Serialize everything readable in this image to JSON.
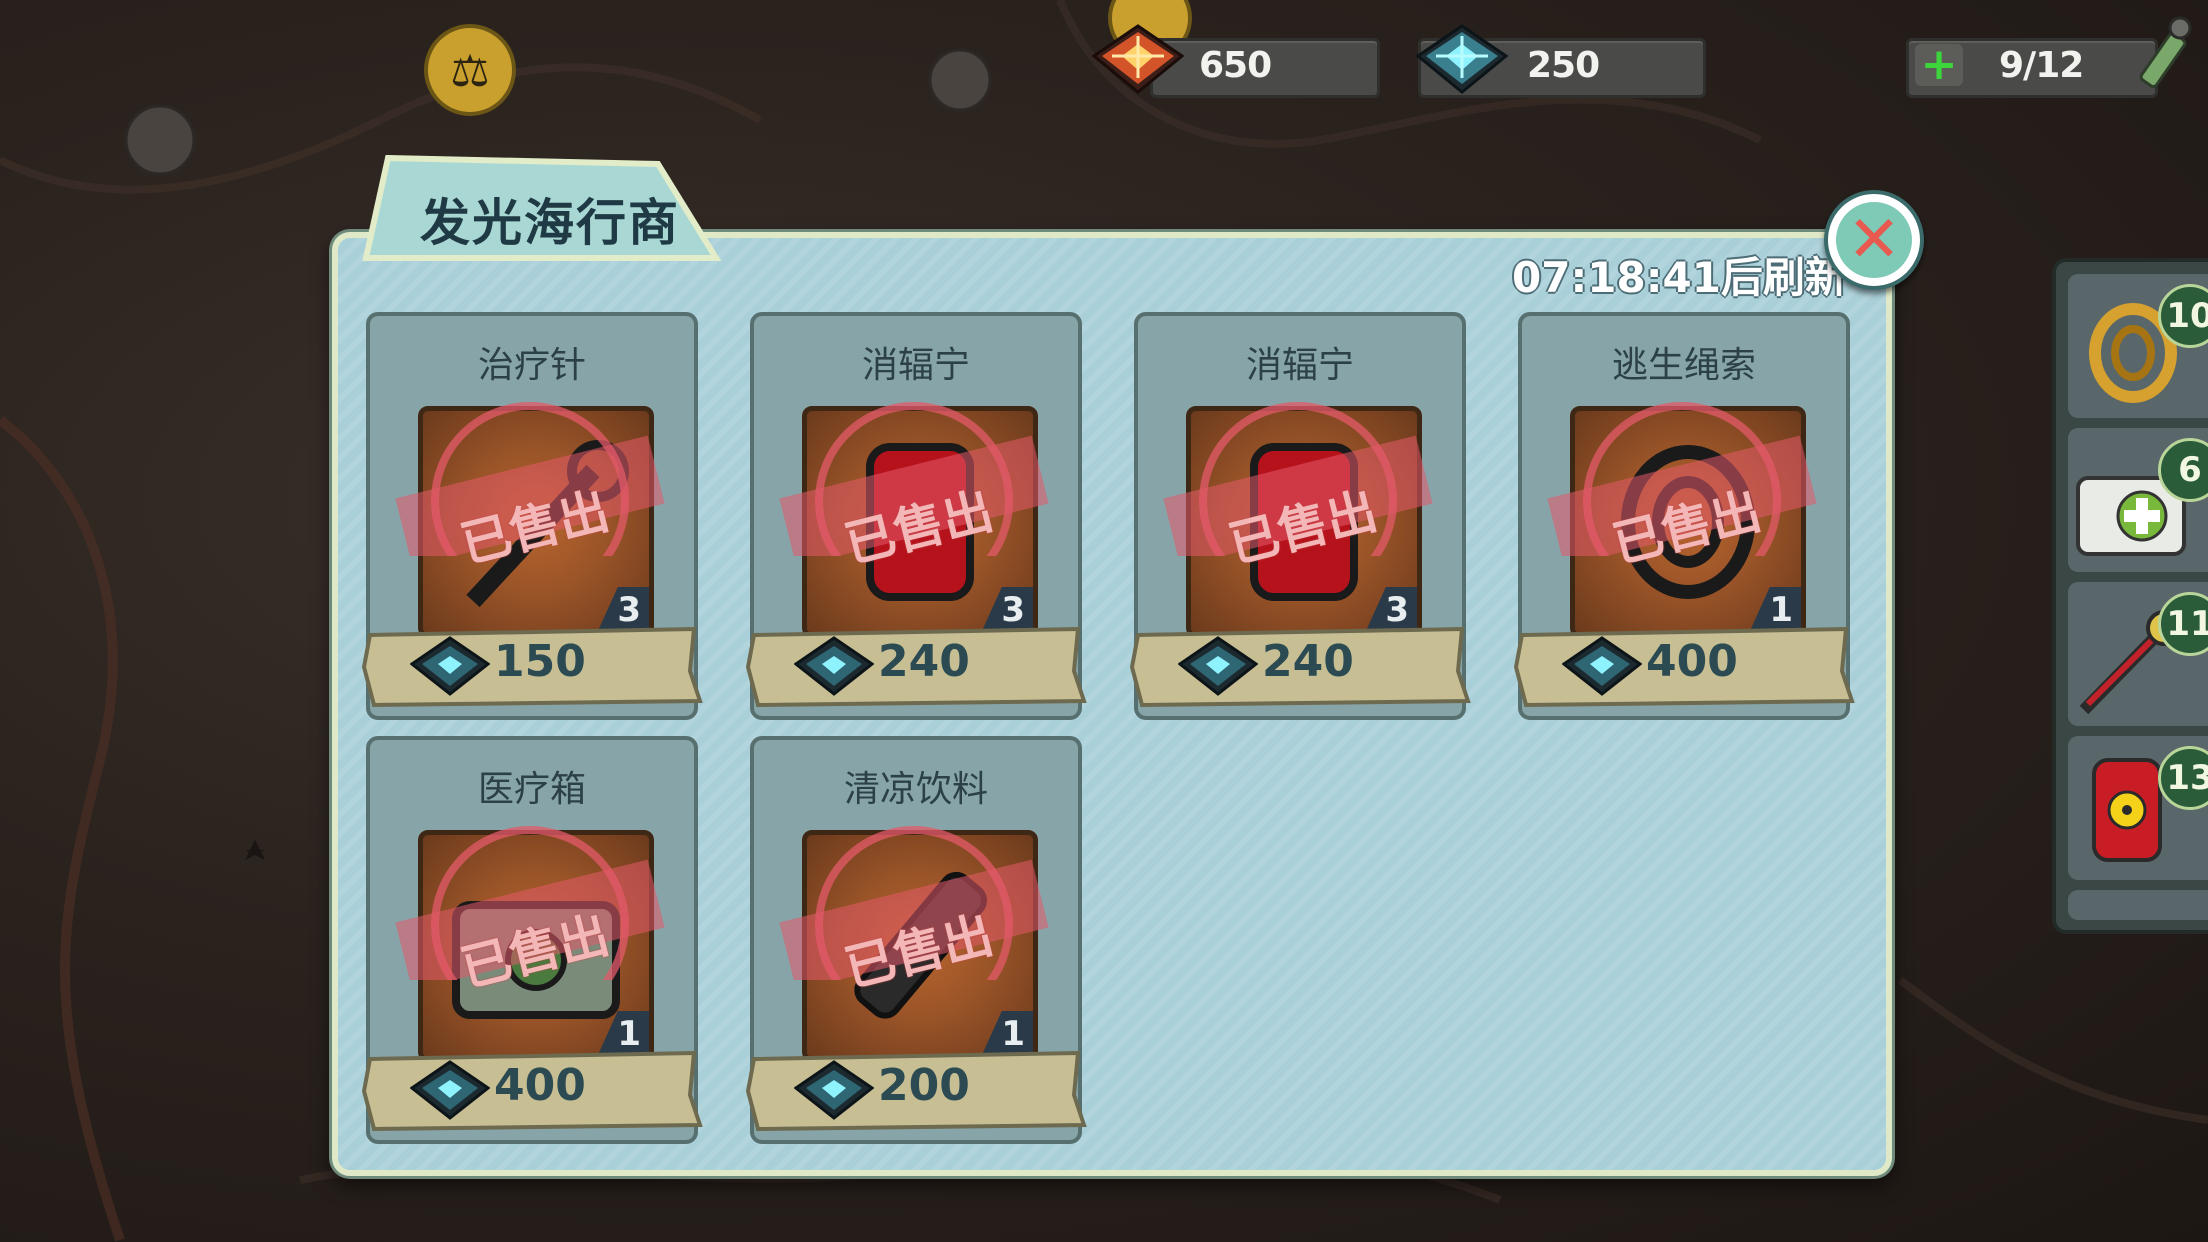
{
  "resources": {
    "red_chip": {
      "value": "650",
      "icon": "red-chip-icon",
      "color": "#e05a2b"
    },
    "blue_chip": {
      "value": "250",
      "icon": "blue-chip-icon",
      "color": "#2fa8b8"
    },
    "energy": {
      "value": "9/12",
      "icon": "plus-icon"
    }
  },
  "shop": {
    "title": "发光海行商",
    "refresh_text": "07:18:41后刷新",
    "sold_label": "已售出",
    "items": [
      {
        "name": "治疗针",
        "price": "150",
        "stock": "3",
        "icon": "stimpak-icon"
      },
      {
        "name": "消辐宁",
        "price": "240",
        "stock": "3",
        "icon": "radaway-icon"
      },
      {
        "name": "消辐宁",
        "price": "240",
        "stock": "3",
        "icon": "radaway-icon"
      },
      {
        "name": "逃生绳索",
        "price": "400",
        "stock": "1",
        "icon": "rope-icon"
      },
      {
        "name": "医疗箱",
        "price": "400",
        "stock": "1",
        "icon": "medkit-icon"
      },
      {
        "name": "清凉饮料",
        "price": "200",
        "stock": "1",
        "icon": "soda-icon"
      }
    ]
  },
  "inventory": [
    {
      "count": "10",
      "icon": "rope-icon"
    },
    {
      "count": "6",
      "icon": "medkit-icon"
    },
    {
      "count": "11",
      "icon": "stimpak-icon"
    },
    {
      "count": "13",
      "icon": "radaway-icon"
    }
  ]
}
